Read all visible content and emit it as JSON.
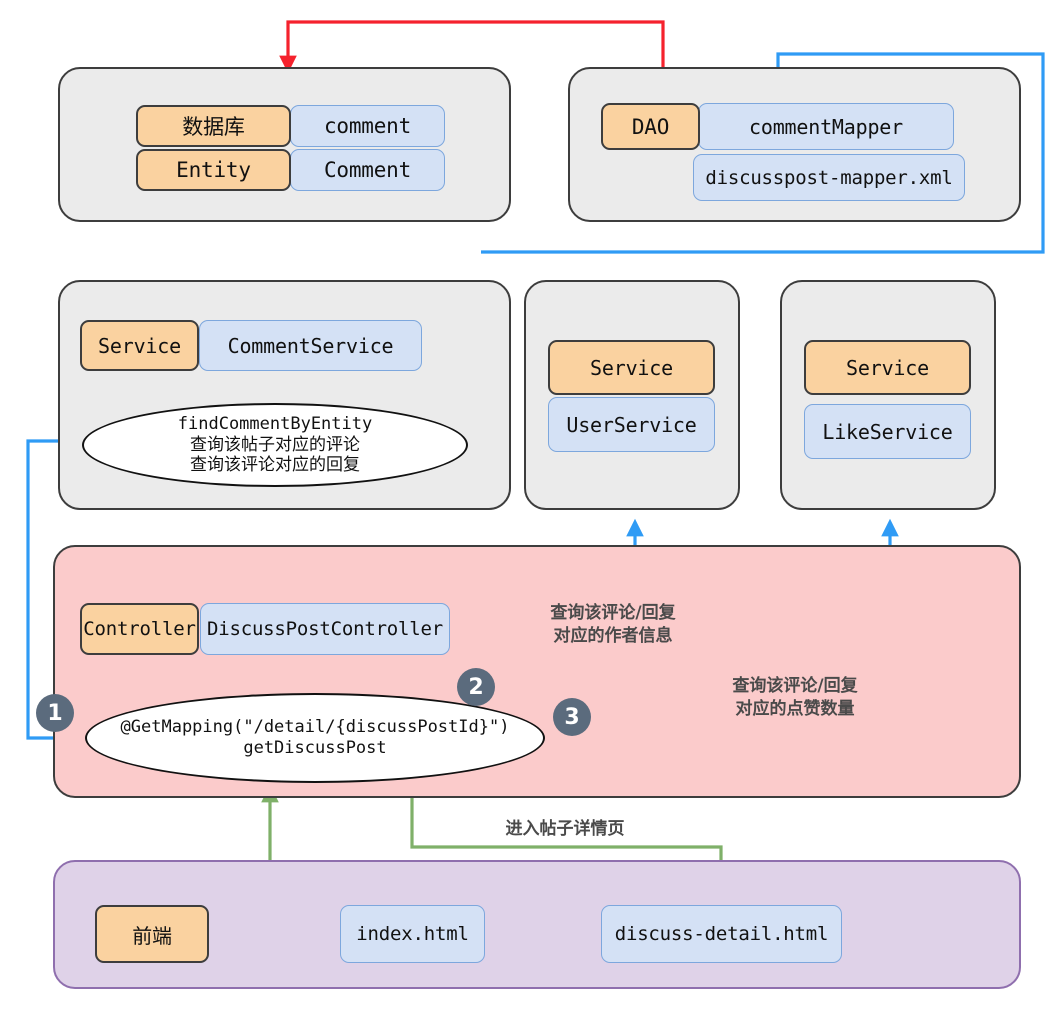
{
  "diagram": {
    "title": "Comment module layered architecture flow",
    "colors": {
      "orange_chip": "#fad2a0",
      "blue_chip": "#d4e1f5",
      "gray_panel": "#ebebeb",
      "pink_panel": "#fbcbcb",
      "purple_panel": "#dfd2e8",
      "red_arrow": "#f5222d",
      "blue_arrow": "#2f9bf5",
      "green_arrow": "#7fb069",
      "badge": "#5b6b7d"
    }
  },
  "panels": {
    "database": {
      "rows": [
        {
          "tag": "数据库",
          "value": "comment"
        },
        {
          "tag": "Entity",
          "value": "Comment"
        }
      ]
    },
    "dao": {
      "tag": "DAO",
      "items": [
        "commentMapper",
        "discusspost-mapper.xml"
      ]
    },
    "comment_service": {
      "tag": "Service",
      "name": "CommentService",
      "method": {
        "line1": "findCommentByEntity",
        "line2": "查询该帖子对应的评论",
        "line3": "查询该评论对应的回复"
      }
    },
    "user_service": {
      "tag": "Service",
      "name": "UserService"
    },
    "like_service": {
      "tag": "Service",
      "name": "LikeService"
    },
    "controller": {
      "tag": "Controller",
      "name": "DiscussPostController",
      "method": {
        "line1": "@GetMapping(\"/detail/{discussPostId}\")",
        "line2": "getDiscussPost"
      }
    },
    "frontend": {
      "tag": "前端",
      "pages": [
        "index.html",
        "discuss-detail.html"
      ]
    }
  },
  "badges": [
    {
      "id": "badge-1",
      "label": "1"
    },
    {
      "id": "badge-2",
      "label": "2"
    },
    {
      "id": "badge-3",
      "label": "3"
    }
  ],
  "annotations": {
    "author_info": "查询该评论/回复\n对应的作者信息",
    "like_count": "查询该评论/回复\n对应的点赞数量",
    "enter_detail": "进入帖子详情页"
  }
}
